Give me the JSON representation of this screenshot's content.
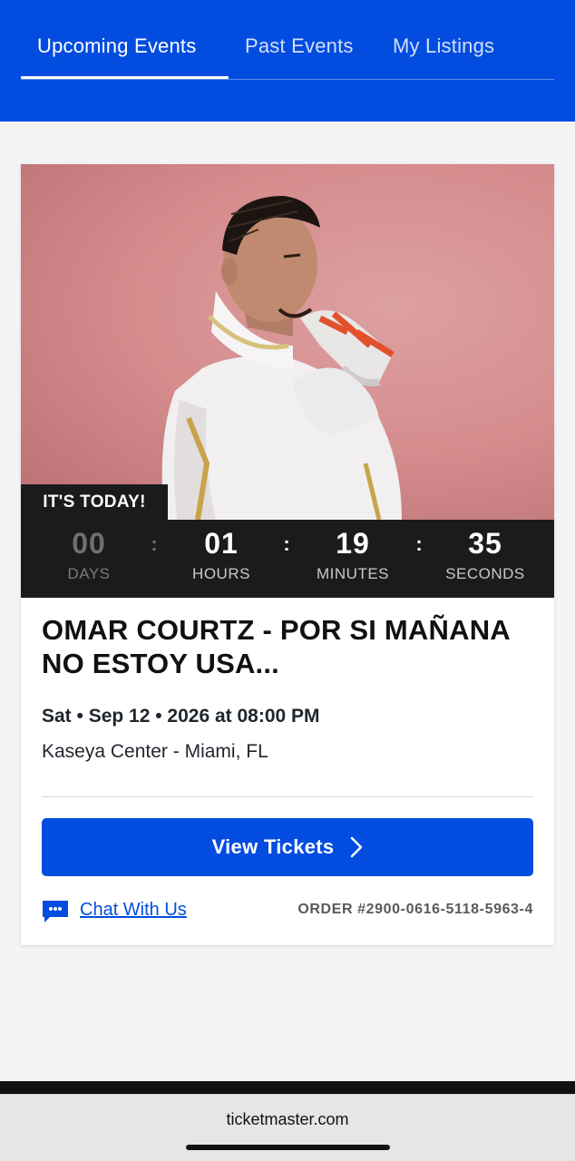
{
  "nav": {
    "tabs": [
      {
        "label": "Upcoming Events",
        "active": true
      },
      {
        "label": "Past Events",
        "active": false
      },
      {
        "label": "My Listings",
        "active": false
      }
    ]
  },
  "event": {
    "badge": "IT'S TODAY!",
    "countdown": {
      "days": {
        "value": "00",
        "label": "DAYS"
      },
      "hours": {
        "value": "01",
        "label": "HOURS"
      },
      "minutes": {
        "value": "19",
        "label": "MINUTES"
      },
      "seconds": {
        "value": "35",
        "label": "SECONDS"
      }
    },
    "title": "OMAR COURTZ - POR SI MAÑANA NO ESTOY USA...",
    "date": "Sat • Sep 12 • 2026 at 08:00 PM",
    "venue": "Kaseya Center - Miami, FL",
    "view_tickets_label": "View Tickets",
    "chat_label": "Chat With Us",
    "order_number": "ORDER #2900-0616-5118-5963-4"
  },
  "browser": {
    "url": "ticketmaster.com"
  },
  "colors": {
    "brand_blue": "#024ddf",
    "countdown_bg": "#1b1b1b",
    "photo_bg": "#d68e8f"
  }
}
